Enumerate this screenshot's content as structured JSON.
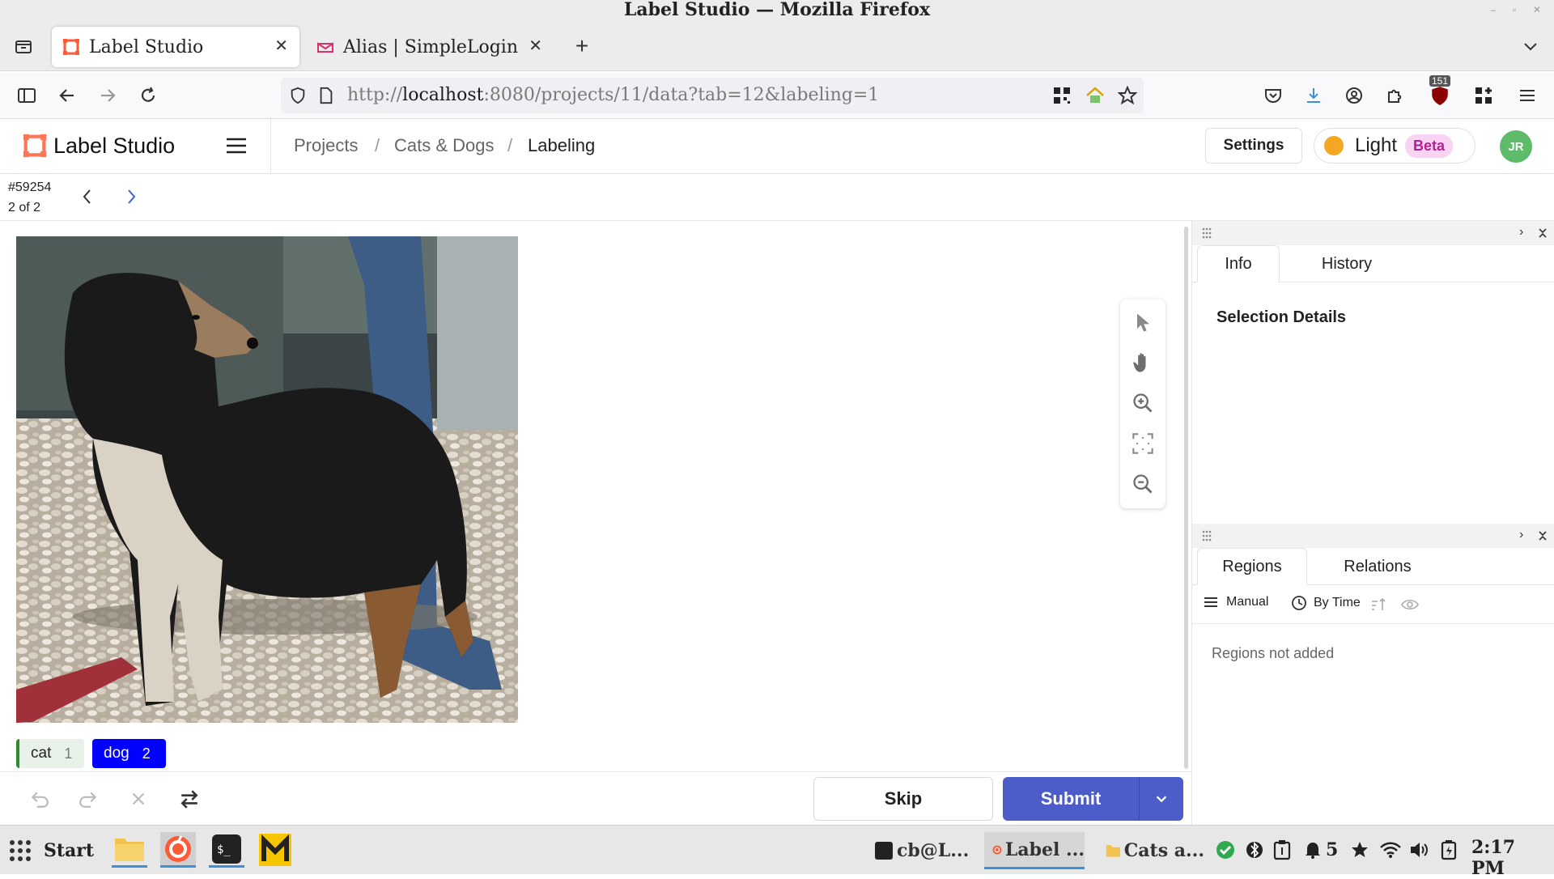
{
  "window": {
    "title": "Label Studio — Mozilla Firefox"
  },
  "tabs": [
    {
      "label": "Label Studio",
      "active": true
    },
    {
      "label": "Alias | SimpleLogin",
      "active": false
    }
  ],
  "nav": {
    "url_prefix": "http://",
    "url_host": "localhost",
    "url_rest": ":8080/projects/11/data?tab=12&labeling=1",
    "badge_count": "151"
  },
  "app": {
    "brand": "Label Studio",
    "breadcrumb": [
      "Projects",
      "Cats & Dogs",
      "Labeling"
    ],
    "settings_label": "Settings",
    "theme_label": "Light",
    "beta_label": "Beta",
    "avatar_initials": "JR"
  },
  "task": {
    "id": "#59254",
    "position": "2 of 2"
  },
  "labels": [
    {
      "name": "cat",
      "hotkey": "1",
      "color": "#2e8b2e"
    },
    {
      "name": "dog",
      "hotkey": "2",
      "color": "#0000ff"
    }
  ],
  "actions": {
    "skip": "Skip",
    "submit": "Submit"
  },
  "side_top": {
    "tabs": [
      "Info",
      "History"
    ],
    "heading": "Selection Details"
  },
  "side_bottom": {
    "tabs": [
      "Regions",
      "Relations"
    ],
    "manual": "Manual",
    "by_time": "By Time",
    "empty": "Regions not added"
  },
  "os_taskbar": {
    "start": "Start",
    "tasks": [
      "cb@L...",
      "Label ...",
      "Cats a..."
    ],
    "notif_count": "5",
    "clock": "2:17 PM"
  },
  "colors": {
    "accent": "#4c5dc9",
    "brand": "#ff7557"
  }
}
